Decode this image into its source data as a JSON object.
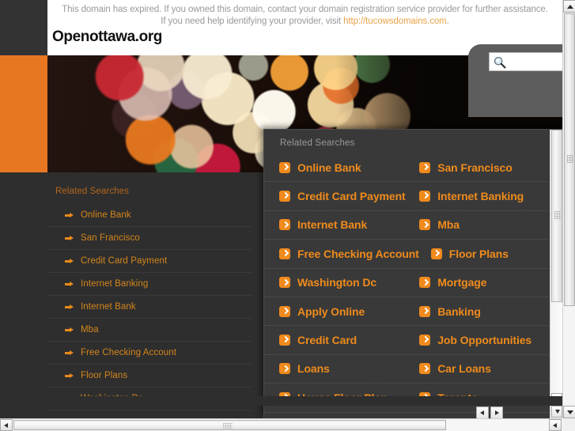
{
  "notice": {
    "text_before": "This domain has expired. If you owned this domain, contact your domain registration service provider for further assistance. If you need help identifying your provider, visit ",
    "link": "http://tucowsdomains.com",
    "text_after": "."
  },
  "header": {
    "domain_title": "Openottawa.org"
  },
  "search": {
    "value": "",
    "placeholder": "",
    "icon": "magnifier-icon"
  },
  "sidebar": {
    "heading": "Related Searches",
    "items": [
      {
        "label": "Online Bank"
      },
      {
        "label": "San Francisco"
      },
      {
        "label": "Credit Card Payment"
      },
      {
        "label": "Internet Banking"
      },
      {
        "label": "Internet Bank"
      },
      {
        "label": "Mba"
      },
      {
        "label": "Free Checking Account"
      },
      {
        "label": "Floor Plans"
      },
      {
        "label": "Washington Dc"
      }
    ]
  },
  "popup": {
    "heading": "Related Searches",
    "rows": [
      {
        "left": "Online Bank",
        "right": "San Francisco"
      },
      {
        "left": "Credit Card Payment",
        "right": "Internet Banking"
      },
      {
        "left": "Internet Bank",
        "right": "Mba"
      },
      {
        "left": "Free Checking Account",
        "right": "Floor Plans"
      },
      {
        "left": "Washington Dc",
        "right": "Mortgage"
      },
      {
        "left": "Apply Online",
        "right": "Banking"
      },
      {
        "left": "Credit Card",
        "right": "Job Opportunities"
      },
      {
        "left": "Loans",
        "right": "Car Loans"
      },
      {
        "left": "House Floor Plan",
        "right": "Toronto"
      }
    ]
  },
  "colors": {
    "accent_orange": "#ef8b1c",
    "block_orange": "#e87722",
    "page_dark": "#2e2e2e",
    "panel_dark": "#393939",
    "link_orange": "#e8a44a"
  }
}
